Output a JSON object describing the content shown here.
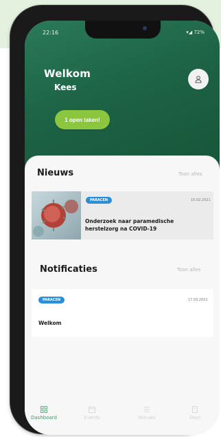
{
  "status_bar": {
    "time": "22:16",
    "right": "72%"
  },
  "header": {
    "welcome": "Welkom",
    "user": "Kees",
    "tasks_button": "1 open taken!"
  },
  "news": {
    "title": "Nieuws",
    "see_all": "Toon alles",
    "item": {
      "tag": "PARACEN",
      "date": "15.02.2021",
      "title": "Onderzoek naar paramedische herstelzorg na COVID-19"
    }
  },
  "notifications": {
    "title": "Notificaties",
    "see_all": "Toon alles",
    "item": {
      "tag": "PARACEN",
      "date": "17.03.2021",
      "title": "Welkom"
    }
  },
  "tabbar": {
    "items": [
      {
        "label": "Dashboard",
        "icon": "dashboard-icon",
        "active": true
      },
      {
        "label": "Events",
        "icon": "events-icon",
        "active": false
      },
      {
        "label": "Nieuws",
        "icon": "news-icon",
        "active": false
      },
      {
        "label": "Doel",
        "icon": "goal-icon",
        "active": false
      }
    ]
  },
  "colors": {
    "header_green": "#1d6346",
    "task_button": "#8cc63f",
    "tag_blue": "#2a8fd6",
    "active_tab": "#35a06a"
  }
}
